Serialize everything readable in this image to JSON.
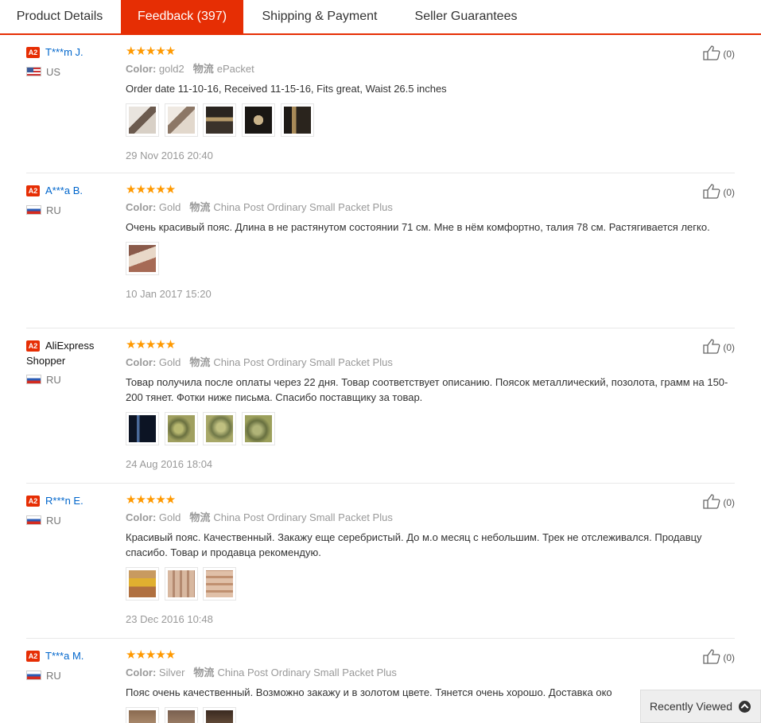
{
  "tabs": [
    {
      "label": "Product Details"
    },
    {
      "label": "Feedback (397)"
    },
    {
      "label": "Shipping & Payment"
    },
    {
      "label": "Seller Guarantees"
    }
  ],
  "labels": {
    "color": "Color:",
    "shipping": "物流",
    "badge": "A2"
  },
  "colors": {
    "accent": "#e62e04",
    "link": "#0066cc",
    "star": "#ff9900"
  },
  "reviews": [
    {
      "name": "T***m J.",
      "country": "US",
      "stars": "★★★★★",
      "rating": 5,
      "color": "gold2",
      "shipping": "ePacket",
      "text": "Order date 11-10-16, Received 11-15-16, Fits great, Waist 26.5 inches",
      "date": "29 Nov 2016 20:40",
      "likes": "(0)"
    },
    {
      "name": "A***a B.",
      "country": "RU",
      "stars": "★★★★★",
      "rating": 5,
      "color": "Gold",
      "shipping": "China Post Ordinary Small Packet Plus",
      "text": "Очень красивый пояс. Длина в не растянутом состоянии 71 см. Мне в нём комфортно, талия 78 см. Растягивается легко.",
      "date": "10 Jan 2017 15:20",
      "likes": "(0)"
    },
    {
      "name": "AliExpress Shopper",
      "country": "RU",
      "stars": "★★★★★",
      "rating": 5,
      "color": "Gold",
      "shipping": "China Post Ordinary Small Packet Plus",
      "text": "Товар получила после оплаты через 22 дня. Товар соответствует описанию. Поясок металлический, позолота, грамм на 150-200 тянет. Фотки ниже письма. Спасибо поставщику за товар.",
      "date": "24 Aug 2016 18:04",
      "likes": "(0)"
    },
    {
      "name": "R***n E.",
      "country": "RU",
      "stars": "★★★★★",
      "rating": 5,
      "color": "Gold",
      "shipping": "China Post Ordinary Small Packet Plus",
      "text": "Красивый пояс. Качественный. Закажу еще серебристый. До м.о месяц с небольшим. Трек не отслеживался. Продавцу спасибо. Товар и продавца рекомендую.",
      "date": "23 Dec 2016 10:48",
      "likes": "(0)"
    },
    {
      "name": "T***a M.",
      "country": "RU",
      "stars": "★★★★★",
      "rating": 5,
      "color": "Silver",
      "shipping": "China Post Ordinary Small Packet Plus",
      "text": "Пояс очень качественный. Возможно закажу и в золотом цвете. Тянется очень хорошо. Доставка око",
      "date": "",
      "likes": "(0)"
    }
  ],
  "recently_viewed": {
    "label": "Recently Viewed"
  }
}
